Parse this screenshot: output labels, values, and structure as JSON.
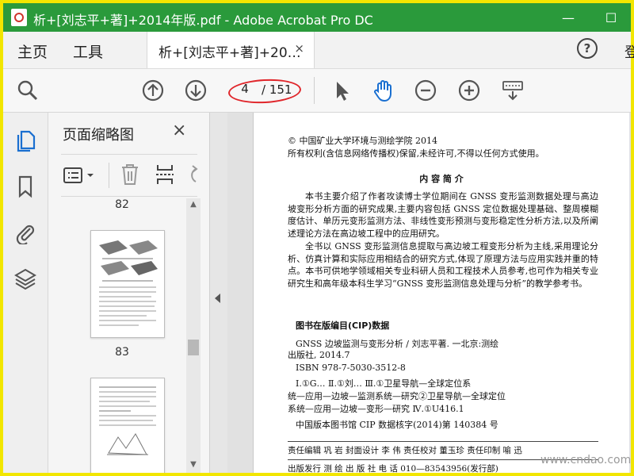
{
  "window": {
    "title": "析+[刘志平+著]+2014年版.pdf - Adobe Acrobat Pro DC",
    "minimize": "—",
    "maximize": "☐",
    "icon": "acrobat-pdf-icon"
  },
  "menubar": {
    "home": "主页",
    "tools": "工具",
    "doc_tab": "析+[刘志平+著]+20…",
    "doc_tab_close": "×",
    "help": "?",
    "sign_in": "登"
  },
  "toolbar": {
    "current_page": "4",
    "total_pages": "/ 151",
    "icons": [
      "search-zoom-icon",
      "page-up-icon",
      "page-down-icon",
      "select-cursor-icon",
      "hand-icon",
      "zoom-out-icon",
      "zoom-in-icon",
      "keyboard-scroll-icon"
    ]
  },
  "left_rail": {
    "icons": [
      "page-thumbnails-icon",
      "bookmark-icon",
      "attachment-icon",
      "layers-icon"
    ]
  },
  "thumbnail_panel": {
    "title": "页面缩略图",
    "close": "×",
    "prev_label": "82",
    "label": "83"
  },
  "document": {
    "copyright": "© 中国矿业大学环境与测绘学院 2014",
    "rights": "所有权利(含信息网络传播权)保留,未经许可,不得以任何方式使用。",
    "summary_heading": "内 容 简 介",
    "para1": "本书主要介绍了作者攻读博士学位期间在 GNSS 变形监测数据处理与高边坡变形分析方面的研究成果,主要内容包括 GNSS 定位数据处理基础、整周模糊度估计、单历元变形监测方法、非线性变形预测与变形稳定性分析方法,以及所阐述理论方法在高边坡工程中的应用研究。",
    "para2": "全书以 GNSS 变形监测信息提取与高边坡工程变形分析为主线,采用理论分析、仿真计算和实际应用相结合的研究方式,体现了原理方法与应用实践并重的特点。本书可供地学领域相关专业科研人员和工程技术人员参考,也可作为相关专业研究生和高年级本科生学习“GNSS 变形监测信息处理与分析”的教学参考书。",
    "cip_heading": "图书在版编目(CIP)数据",
    "cip_line1": "GNSS 边坡监测与变形分析 / 刘志平著. 一北京:测绘",
    "cip_line2": "出版社, 2014.7",
    "cip_line3": "ISBN 978-7-5030-3512-8",
    "cip_line4": "Ⅰ.①G…   Ⅱ.①刘…   Ⅲ.①卫星导航—全球定位系",
    "cip_line5": "统—应用—边坡—监测系统—研究②卫星导航—全球定位",
    "cip_line6": "系统—应用—边坡—变形—研究   Ⅳ.①U416.1",
    "cip_number": "中国版本图书馆 CIP 数据核字(2014)第 140384 号",
    "credits1": "责任编辑  巩  岩    封面设计  李  伟    责任校对  董玉珍    责任印制  喻  迅",
    "credits2": "出版发行  测  绘  出  版  社                    电  话  010—83543956(发行部)"
  },
  "watermark": "www.cndao.com"
}
